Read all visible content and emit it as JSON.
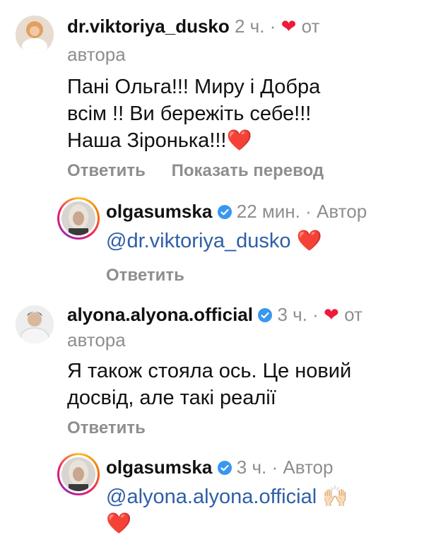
{
  "comments": [
    {
      "username": "dr.viktoriya_dusko",
      "time": "2 ч.",
      "sep": "·",
      "liked_label_1": "от",
      "liked_label_2": "автора",
      "lines": [
        "Пані Ольга!!! Миру і Добра",
        "всім !! Ви бережіть себе!!!",
        "Наша Зіронька!!!"
      ],
      "trailing_emoji": "❤️",
      "reply_label": "Ответить",
      "translate_label": "Показать перевод"
    },
    {
      "username": "olgasumska",
      "time": "22 мин.",
      "sep": "·",
      "author_label": "Автор",
      "mention": "@dr.viktoriya_dusko",
      "trailing_emoji": "❤️",
      "reply_label": "Ответить"
    },
    {
      "username": "alyona.alyona.official",
      "time": "3 ч.",
      "sep": "·",
      "liked_label_1": "от",
      "liked_label_2": "автора",
      "lines": [
        "Я також стояла ось. Це новий",
        "досвід, але такі реалії"
      ],
      "reply_label": "Ответить"
    },
    {
      "username": "olgasumska",
      "time": "3 ч.",
      "sep": "·",
      "author_label": "Автор",
      "mention": "@alyona.alyona.official",
      "trailing_emoji": "🙌🏻",
      "second_line_emoji": "❤️"
    }
  ],
  "colors": {
    "heart": "#ed1c3a",
    "verified": "#3897f0",
    "mention": "#2e5fa7",
    "secondary_text": "#8e8e8e"
  },
  "icons": {
    "liked_by_author": "heart-icon",
    "verified_badge": "verified-badge-icon"
  }
}
